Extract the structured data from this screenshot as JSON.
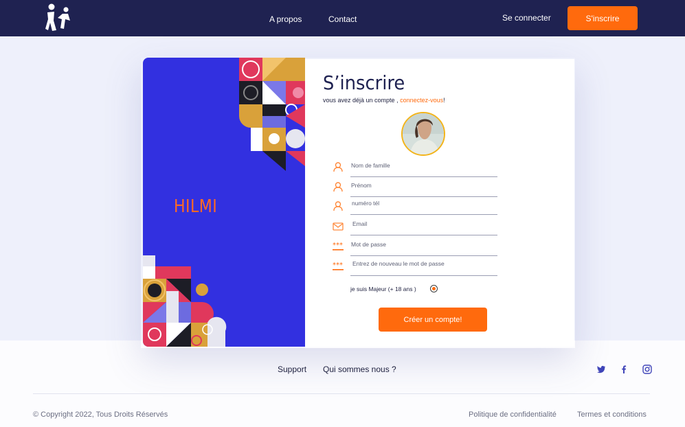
{
  "nav": {
    "logo_icon": "people-logo-icon",
    "links": [
      "A propos",
      "Contact"
    ],
    "login_label": "Se connecter",
    "signup_label": "S'inscrire"
  },
  "brand": {
    "name": "HILMI"
  },
  "form": {
    "title": "S’inscrire",
    "subtitle_prefix": "vous avez déjà un compte ,",
    "subtitle_link": "connectez-vous",
    "subtitle_suffix": "!",
    "avatar_icon": "profile-photo",
    "fields": [
      {
        "icon": "user-icon",
        "placeholder": "Nom de famille"
      },
      {
        "icon": "user-icon",
        "placeholder": "Prénom"
      },
      {
        "icon": "user-icon",
        "placeholder": "numéro tél"
      },
      {
        "icon": "mail-icon",
        "placeholder": "Email"
      },
      {
        "icon": "password-icon",
        "placeholder": "Mot de passe"
      },
      {
        "icon": "password-icon",
        "placeholder": "Entrez de nouveau le mot de passe"
      }
    ],
    "age_label": "je suis Majeur (+ 18 ans )",
    "age_checked": true,
    "submit_label": "Créer un compte!"
  },
  "footer": {
    "links": [
      "Support",
      "Qui sommes nous ?"
    ],
    "social_icons": [
      "twitter-icon",
      "facebook-icon",
      "instagram-icon"
    ],
    "copyright": "© Copyright 2022, Tous Droits Réservés",
    "privacy": "Politique de confidentialité",
    "terms": "Termes et conditions"
  },
  "colors": {
    "navy": "#1f2251",
    "accent": "#ff6a0d",
    "panel_blue": "#3230e0",
    "background": "#eef0fb"
  }
}
